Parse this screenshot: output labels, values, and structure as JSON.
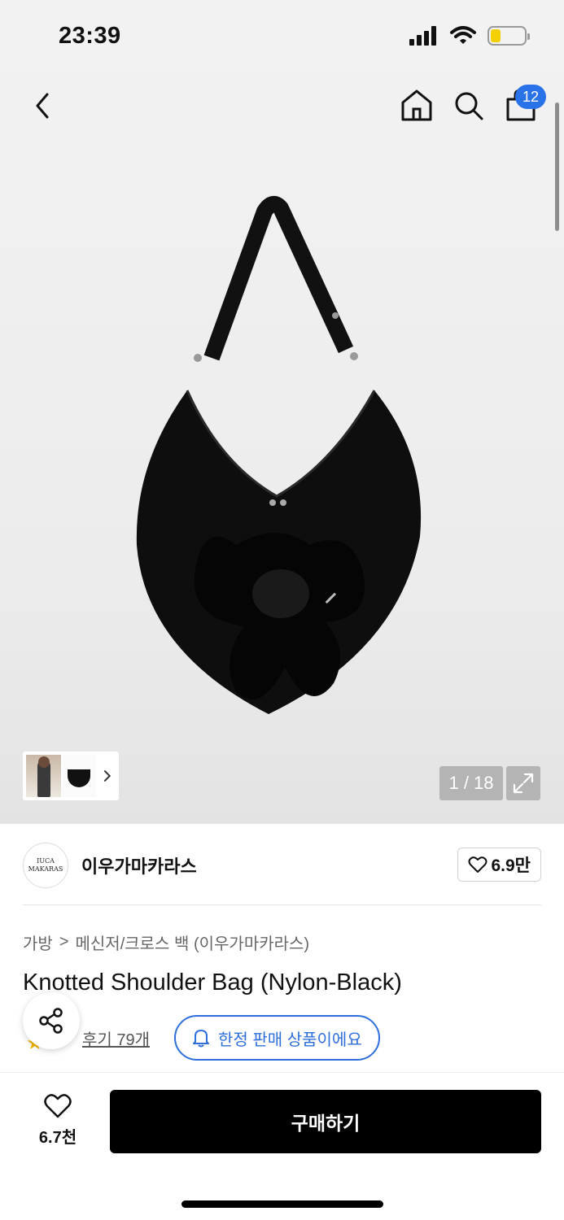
{
  "status_bar": {
    "time": "23:39"
  },
  "nav": {
    "cart_count": "12"
  },
  "gallery": {
    "counter": "1 / 18",
    "product_image": "Knotted black nylon shoulder bag with bow",
    "thumbnails": [
      "model-thumbnail",
      "bag-thumbnail"
    ]
  },
  "brand": {
    "logo_line1": "IUCA",
    "logo_line2": "MAKARAS",
    "name": "이우가마카라스",
    "likes": "6.9만"
  },
  "breadcrumb": {
    "category": "가방",
    "separator": ">",
    "subcategory": "메신저/크로스 백 (이우가마카라스)"
  },
  "product": {
    "title": "Knotted Shoulder Bag (Nylon-Black)"
  },
  "reviews": {
    "label": "후기 79개"
  },
  "limited_badge": {
    "label": "한정 판매 상품이에요"
  },
  "bottom": {
    "wish_count": "6.7천",
    "buy_label": "구매하기"
  },
  "colors": {
    "accent_blue": "#2f6fdb",
    "badge_blue": "#2a72e8",
    "battery": "#f5d000"
  }
}
